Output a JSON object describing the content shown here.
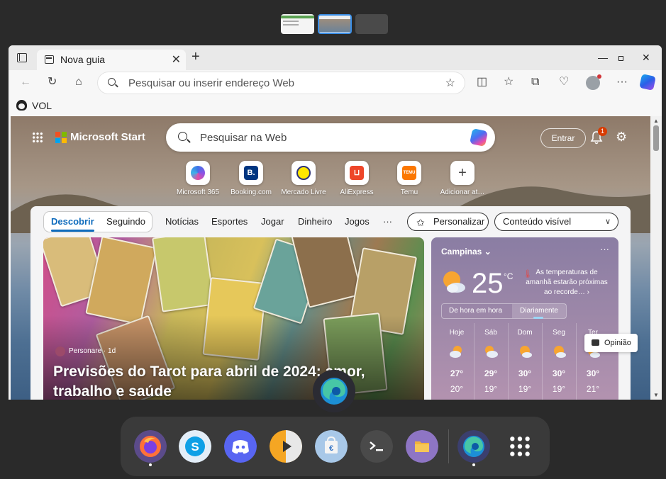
{
  "tab": {
    "title": "Nova guia"
  },
  "address_bar": {
    "placeholder": "Pesquisar ou inserir endereço Web"
  },
  "favorites": {
    "label": "VOL"
  },
  "start": {
    "brand": "Microsoft Start",
    "search_placeholder": "Pesquisar na Web",
    "signin_label": "Entrar",
    "notification_count": "1"
  },
  "quick_links": [
    {
      "label": "Microsoft 365",
      "color": "#4f6bed"
    },
    {
      "label": "Booking.com",
      "color": "#003580",
      "glyph": "B."
    },
    {
      "label": "Mercado Livre",
      "color": "#ffe600"
    },
    {
      "label": "AliExpress",
      "color": "#ee4629"
    },
    {
      "label": "Temu",
      "color": "#fb7701",
      "glyph": "TEMU"
    },
    {
      "label": "Adicionar at…",
      "color": "#ffffff",
      "glyph": "+"
    }
  ],
  "feed_nav": {
    "discover": "Descobrir",
    "following": "Seguindo",
    "links": [
      "Notícias",
      "Esportes",
      "Jogar",
      "Dinheiro",
      "Jogos",
      "···"
    ],
    "personalize": "Personalizar",
    "visibility": "Conteúdo visível"
  },
  "hero": {
    "source": "Personare · 1d",
    "headline": "Previsões do Tarot para abril de 2024: amor, trabalho e saúde"
  },
  "weather": {
    "city": "Campinas",
    "temperature": "25",
    "unit": "°C",
    "alert": "As temperaturas de amanhã estarão próximas ao recorde…",
    "toggle_hourly": "De hora em hora",
    "toggle_daily": "Diariamente",
    "days": [
      {
        "name": "Hoje",
        "high": "27°",
        "low": "20°"
      },
      {
        "name": "Sáb",
        "high": "29°",
        "low": "19°"
      },
      {
        "name": "Dom",
        "high": "30°",
        "low": "19°"
      },
      {
        "name": "Seg",
        "high": "30°",
        "low": "19°"
      },
      {
        "name": "Ter",
        "high": "30°",
        "low": "21°"
      }
    ]
  },
  "feedback": {
    "label": "Opinião"
  },
  "dock": {
    "apps": [
      "firefox",
      "skype",
      "discord",
      "media-player",
      "software-store",
      "terminal",
      "files",
      "edge",
      "app-grid"
    ]
  },
  "colors": {
    "accent": "#0f6cbd",
    "dock": "#3a3a3a",
    "desktop": "#2a2a2a"
  }
}
